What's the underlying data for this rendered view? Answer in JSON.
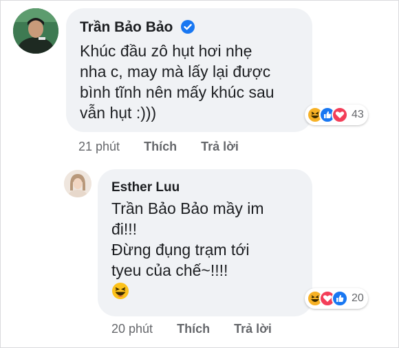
{
  "comments": [
    {
      "author": "Trần Bảo Bảo",
      "verified": true,
      "text_lines": [
        "Khúc đầu zô hụt hơi nhẹ",
        "nha c, may mà lấy lại được",
        "bình tĩnh nên mấy khúc sau",
        "vẫn hụt :)))"
      ],
      "reactions": [
        "haha-icon",
        "like-icon",
        "love-icon"
      ],
      "reaction_count": "43",
      "time": "21 phút",
      "like_label": "Thích",
      "reply_label": "Trả lời"
    },
    {
      "author": "Esther Luu",
      "verified": false,
      "mention": "Trần Bảo Bảo",
      "text_lines": [
        " mầy im",
        "đi!!!",
        "Đừng đụng trạm tới",
        "tyeu của chế~!!!!"
      ],
      "reactions": [
        "haha-icon",
        "love-icon",
        "like-icon"
      ],
      "reaction_count": "20",
      "time": "20 phút",
      "like_label": "Thích",
      "reply_label": "Trả lời"
    }
  ],
  "colors": {
    "bubble": "#f0f2f5",
    "meta_text": "#65676b",
    "like_blue": "#1877f2",
    "love_red": "#f33e58",
    "haha_yellow": "#f7b125"
  }
}
